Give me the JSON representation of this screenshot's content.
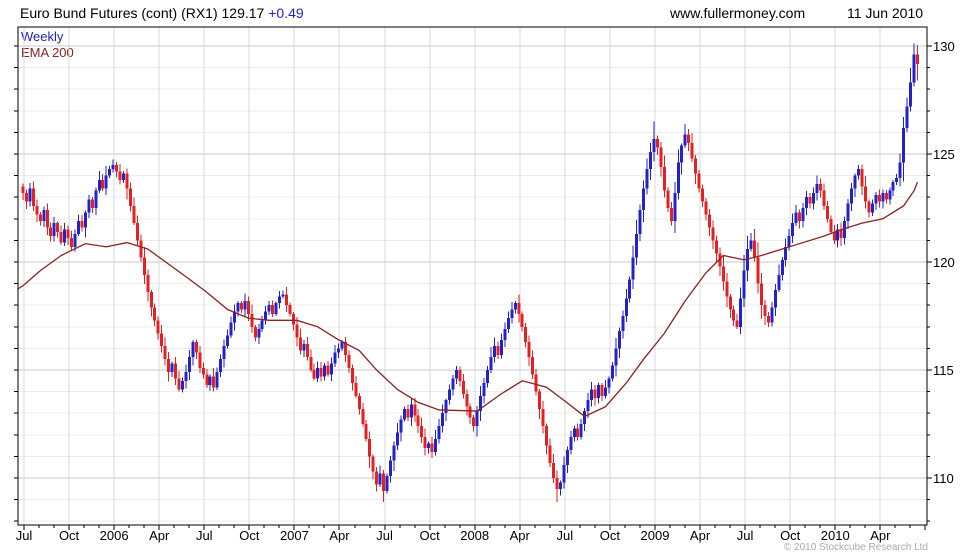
{
  "header": {
    "title_main": "Euro Bund Futures (cont) (RX1) 129.17",
    "change": " +0.49",
    "website": "www.fullermoney.com",
    "date": "11 Jun 2010"
  },
  "legend": {
    "series1": "Weekly",
    "series2": "EMA 200"
  },
  "footer": {
    "copyright": "© 2010 Stockcube Research Ltd"
  },
  "colors": {
    "up_candle": "#2222cc",
    "down_candle": "#e62020",
    "ema_line": "#8b2121",
    "legend_weekly": "#2222bb",
    "change_text": "#2222cc",
    "grid_minor": "#ededed",
    "grid_major": "#c9c9c9",
    "grid_vertical": "#d9d9d9",
    "axis": "#000000",
    "copyright_text": "#a9a9a9"
  },
  "chart_data": {
    "type": "candlestick",
    "title": "Euro Bund Futures (cont) (RX1)",
    "interval": "weekly",
    "last_price": 129.17,
    "change": 0.49,
    "x_axis": {
      "start": "Jul 2005",
      "end": "11 Jun 2010",
      "labels": [
        "Jul",
        "Oct",
        "2006",
        "Apr",
        "Jul",
        "Oct",
        "2007",
        "Apr",
        "Jul",
        "Oct",
        "2008",
        "Apr",
        "Jul",
        "Oct",
        "2009",
        "Apr",
        "Jul",
        "Oct",
        "2010",
        "Apr"
      ],
      "months_per_tick": 1,
      "quarters_per_label": 1
    },
    "y_axis": {
      "ticks": [
        130,
        125,
        120,
        115,
        110
      ],
      "minor_step": 1,
      "visible_top": 130.9,
      "visible_bottom": 107.9,
      "side": "right"
    },
    "series": [
      {
        "name": "Weekly",
        "type": "candlestick",
        "closes": [
          123.2,
          122.8,
          123.4,
          122.6,
          122.2,
          121.9,
          122.4,
          121.6,
          121.2,
          121.8,
          121.4,
          120.9,
          121.5,
          121.1,
          120.7,
          121.3,
          121.9,
          121.6,
          122.3,
          122.9,
          122.5,
          123.3,
          123.8,
          123.4,
          124.0,
          124.3,
          124.5,
          124.2,
          123.8,
          124.1,
          123.4,
          122.6,
          121.8,
          121.0,
          120.2,
          119.4,
          118.6,
          117.9,
          117.3,
          116.7,
          116.1,
          115.5,
          114.9,
          115.3,
          114.6,
          114.1,
          114.5,
          114.9,
          115.6,
          116.3,
          115.8,
          115.1,
          114.8,
          114.3,
          114.7,
          114.2,
          114.9,
          115.5,
          116.1,
          116.6,
          117.2,
          117.7,
          118.1,
          117.8,
          118.2,
          117.6,
          117.0,
          116.5,
          116.9,
          117.3,
          117.7,
          118.0,
          117.6,
          118.1,
          118.4,
          118.5,
          118.0,
          117.6,
          117.1,
          116.5,
          115.9,
          116.2,
          115.6,
          115.0,
          114.6,
          115.1,
          114.7,
          115.2,
          114.8,
          115.3,
          115.8,
          116.0,
          116.3,
          115.7,
          115.1,
          114.4,
          113.8,
          113.2,
          112.5,
          111.8,
          111.0,
          110.3,
          109.7,
          110.2,
          109.4,
          110.1,
          110.8,
          111.5,
          112.1,
          112.7,
          113.2,
          112.8,
          113.4,
          112.9,
          112.4,
          111.9,
          111.4,
          111.6,
          111.2,
          111.8,
          112.4,
          113.0,
          113.6,
          114.1,
          114.6,
          115.0,
          114.5,
          113.9,
          113.3,
          112.8,
          112.4,
          113.1,
          113.8,
          114.4,
          115.0,
          115.6,
          116.1,
          115.7,
          116.4,
          116.9,
          117.4,
          117.8,
          118.1,
          117.6,
          117.0,
          116.3,
          115.6,
          114.8,
          114.0,
          113.2,
          112.4,
          111.5,
          110.7,
          110.0,
          109.5,
          109.8,
          110.6,
          111.3,
          111.9,
          112.3,
          111.9,
          112.5,
          113.1,
          113.6,
          114.1,
          113.7,
          114.3,
          113.8,
          114.2,
          114.6,
          115.2,
          116.0,
          116.8,
          117.5,
          118.3,
          119.2,
          120.2,
          121.3,
          122.4,
          123.4,
          124.3,
          125.1,
          125.7,
          125.3,
          124.4,
          123.3,
          122.5,
          121.9,
          123.2,
          124.6,
          125.4,
          125.9,
          125.5,
          124.8,
          124.1,
          123.4,
          122.8,
          122.2,
          121.6,
          121.0,
          120.4,
          119.8,
          119.1,
          118.4,
          117.8,
          117.3,
          117.0,
          118.3,
          119.6,
          120.6,
          121.0,
          120.2,
          119.0,
          118.0,
          117.5,
          117.2,
          117.9,
          118.7,
          119.4,
          120.1,
          120.7,
          121.2,
          121.8,
          122.3,
          121.9,
          122.5,
          123.0,
          122.7,
          123.2,
          123.6,
          123.3,
          122.6,
          122.0,
          121.4,
          121.0,
          121.5,
          121.1,
          121.9,
          122.7,
          123.4,
          124.0,
          124.3,
          123.5,
          122.8,
          122.3,
          122.7,
          123.1,
          122.8,
          123.2,
          122.9,
          123.3,
          123.7,
          123.9,
          124.6,
          126.2,
          127.2,
          128.3,
          129.6,
          129.17
        ]
      },
      {
        "name": "EMA 200",
        "type": "line",
        "anchors": [
          [
            -1.5,
            118.75
          ],
          [
            0,
            118.9
          ],
          [
            5,
            119.6
          ],
          [
            11,
            120.3
          ],
          [
            18,
            120.85
          ],
          [
            24,
            120.7
          ],
          [
            30,
            120.9
          ],
          [
            36,
            120.6
          ],
          [
            42,
            119.9
          ],
          [
            48,
            119.2
          ],
          [
            53,
            118.6
          ],
          [
            59,
            117.8
          ],
          [
            65,
            117.4
          ],
          [
            71,
            117.3
          ],
          [
            79,
            117.3
          ],
          [
            85,
            117.0
          ],
          [
            91,
            116.4
          ],
          [
            97,
            115.9
          ],
          [
            102,
            115.0
          ],
          [
            108,
            114.1
          ],
          [
            114,
            113.5
          ],
          [
            120,
            113.15
          ],
          [
            131,
            113.1
          ],
          [
            138,
            113.9
          ],
          [
            144,
            114.5
          ],
          [
            151,
            114.2
          ],
          [
            156,
            113.6
          ],
          [
            162,
            112.85
          ],
          [
            168,
            113.3
          ],
          [
            174,
            114.4
          ],
          [
            179,
            115.5
          ],
          [
            185,
            116.7
          ],
          [
            191,
            118.2
          ],
          [
            197,
            119.5
          ],
          [
            202,
            120.3
          ],
          [
            208,
            120.1
          ],
          [
            213,
            120.3
          ],
          [
            219,
            120.6
          ],
          [
            225,
            120.9
          ],
          [
            231,
            121.2
          ],
          [
            236,
            121.5
          ],
          [
            242,
            121.8
          ],
          [
            248,
            122.0
          ],
          [
            254,
            122.6
          ],
          [
            257,
            123.3
          ],
          [
            258,
            123.7
          ]
        ]
      }
    ],
    "wick_overrides": {
      "104": {
        "lo": 108.9
      },
      "154": {
        "lo": 108.9
      },
      "182": {
        "hi": 126.5
      },
      "191": {
        "hi": 126.4
      },
      "206": {
        "lo": 116.9
      },
      "215": {
        "lo": 117.0
      },
      "229": {
        "hi": 124.0
      },
      "241": {
        "hi": 124.5
      },
      "258": {
        "hi": 130.05,
        "lo": 128.4
      }
    },
    "legend_position": "top-left",
    "grid": "minor 1pt horizontal, quarterly vertical"
  }
}
